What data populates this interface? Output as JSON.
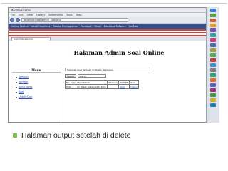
{
  "browser": {
    "window_title": "Mozilla Firefox",
    "menu": [
      "File",
      "Edit",
      "View",
      "History",
      "Bookmarks",
      "Tools",
      "Help"
    ],
    "url": "localhost/soal/admin_soal.php",
    "bookmarks": [
      "Getting Started",
      "Latest Headlines",
      "Tutorial Pemrograman",
      "Facebook",
      "Gmail",
      "Download Software",
      "YouTube"
    ],
    "tab_title": "Soal Online Admin"
  },
  "page": {
    "title": "Halaman Admin Soal Online",
    "menu_heading": "Menu",
    "menu_items": [
      "Tambah",
      "Refresh",
      "Input Kelas",
      "Soal",
      "Untuk Soal"
    ],
    "content_caption": "Halaman Soal Berhasil di Delete Tersimpan",
    "search_button": "Search",
    "search_value": "search",
    "table": {
      "headers": [
        "No. Soal",
        "Mata Kuliah",
        "Id Dosen",
        "NIP/NPM",
        "Soal"
      ],
      "rows": [
        [
          "0001",
          "Dr. Tazuk Sulistyadi,M.Kom",
          "",
          "Ubah",
          "Hapus"
        ]
      ]
    }
  },
  "taskbar": {
    "icon_colors": [
      "#3a7bd5",
      "#5aa03a",
      "#d25a3a",
      "#e0a020",
      "#7a4fbf",
      "#3aa0a0",
      "#d04080",
      "#4a6fb0",
      "#a0a040",
      "#50b050",
      "#c04040",
      "#4090d0",
      "#808080",
      "#30a070",
      "#e07030",
      "#6060c0",
      "#a03080",
      "#40a040",
      "#d0b020",
      "#2080c0"
    ]
  },
  "caption": {
    "text": "Halaman output setelah di delete"
  },
  "colors": {
    "accent_green": "#7ec04a",
    "bookmark_bar": "#3a4f86",
    "link_blue": "#2a4fbf"
  }
}
